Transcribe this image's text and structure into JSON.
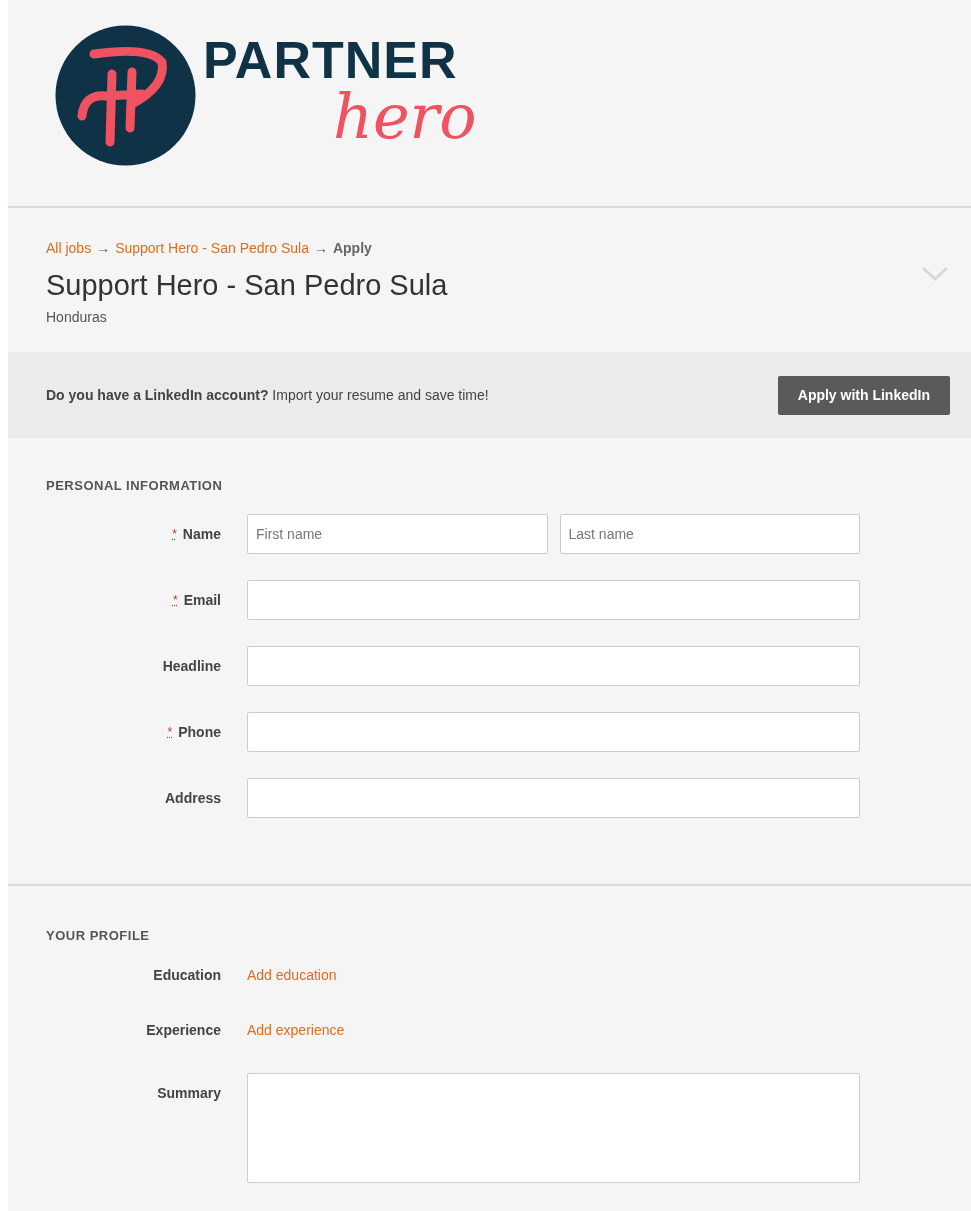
{
  "logo": {
    "top": "PARTNER",
    "bottom": "hero"
  },
  "breadcrumb": [
    {
      "text": "All jobs",
      "kind": "link"
    },
    {
      "text": "→",
      "kind": "separator"
    },
    {
      "text": "Support Hero - San Pedro Sula",
      "kind": "link"
    },
    {
      "text": "→",
      "kind": "separator"
    },
    {
      "text": "Apply",
      "kind": "current"
    }
  ],
  "job": {
    "title": "Support Hero - San Pedro Sula",
    "location": "Honduras"
  },
  "linkedin": {
    "prompt": "**Do you have a LinkedIn account?** Import your resume and save time!",
    "button": "Apply with LinkedIn"
  },
  "required_marker": "*",
  "sections": [
    {
      "heading": "PERSONAL INFORMATION",
      "fields": [
        {
          "label": "Name",
          "kind": "name",
          "required": true,
          "placeholders": [
            "First name",
            "Last name"
          ]
        },
        {
          "label": "Email",
          "kind": "text",
          "required": true
        },
        {
          "label": "Headline",
          "kind": "text",
          "required": false
        },
        {
          "label": "Phone",
          "kind": "text",
          "required": true
        },
        {
          "label": "Address",
          "kind": "text",
          "required": false
        }
      ]
    },
    {
      "heading": "YOUR PROFILE",
      "fields": [
        {
          "label": "Education",
          "kind": "link",
          "required": false,
          "link": "Add education"
        },
        {
          "label": "Experience",
          "kind": "link",
          "required": false,
          "link": "Add experience"
        },
        {
          "label": "Summary",
          "kind": "textarea",
          "required": false
        }
      ]
    }
  ]
}
